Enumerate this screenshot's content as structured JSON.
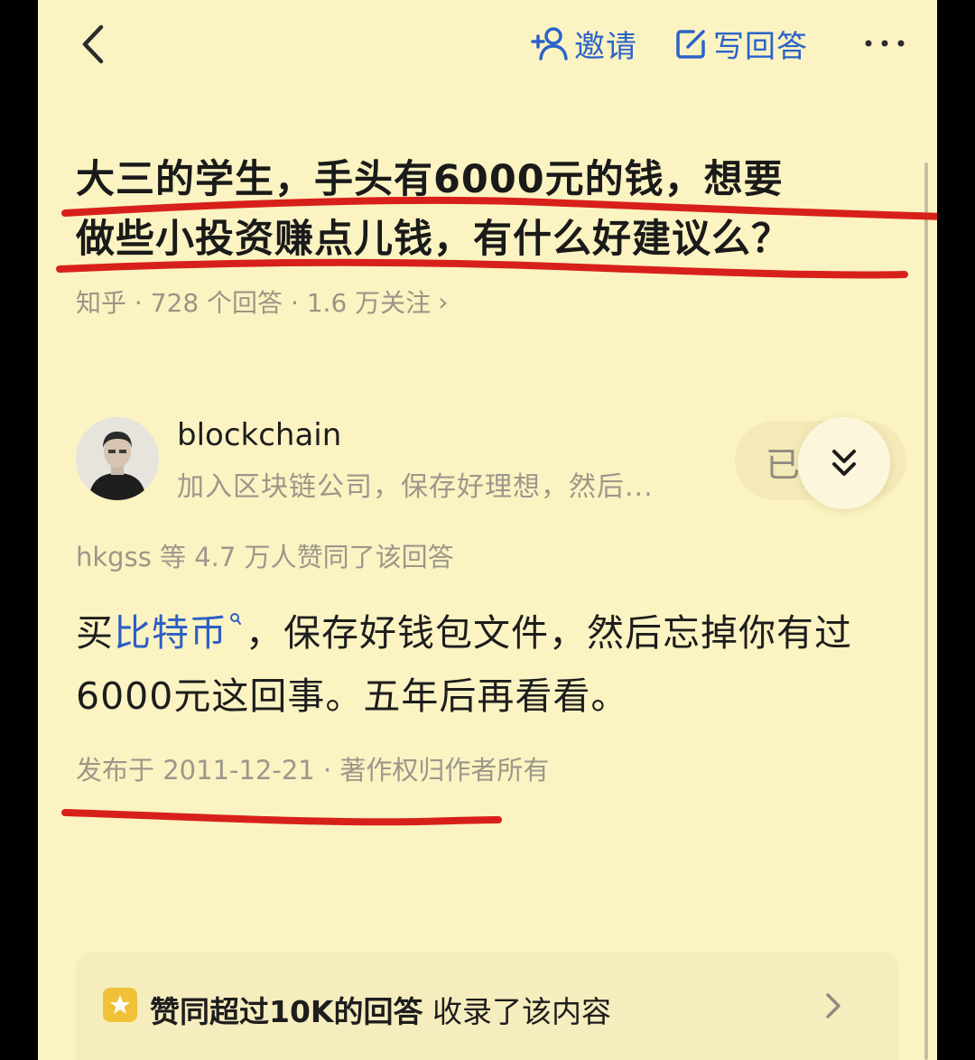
{
  "topbar": {
    "back_icon": "chevron-left-icon",
    "invite_label": "邀请",
    "write_answer_label": "写回答",
    "more_icon": "more-horizontal-icon"
  },
  "question": {
    "line1": "大三的学生，手头有6000元的钱，想要",
    "line2": "做些小投资赚点儿钱，有什么好建议么？",
    "meta": "知乎 · 728 个回答 · 1.6 万关注",
    "meta_chevron": "›"
  },
  "author": {
    "name": "blockchain",
    "bio": "加入区块链公司，保存好理想，然后...",
    "follow_label": "已"
  },
  "votes": {
    "text": "hkgss 等 4.7 万人赞同了该回答"
  },
  "answer": {
    "prefix": "买",
    "link_text": "比特币",
    "line1_rest": "，保存好钱包文件，然后忘掉你有过",
    "line2": "6000元这回事。五年后再看看。"
  },
  "publish": {
    "text": "发布于 2011-12-21 · 著作权归作者所有"
  },
  "badge": {
    "strong": "赞同超过10K的回答",
    "rest": " 收录了该内容"
  },
  "colors": {
    "background": "#fbf3c2",
    "link_blue": "#2b5fc4",
    "annotation_red": "#d8201a",
    "badge_yellow": "#f1c238"
  }
}
